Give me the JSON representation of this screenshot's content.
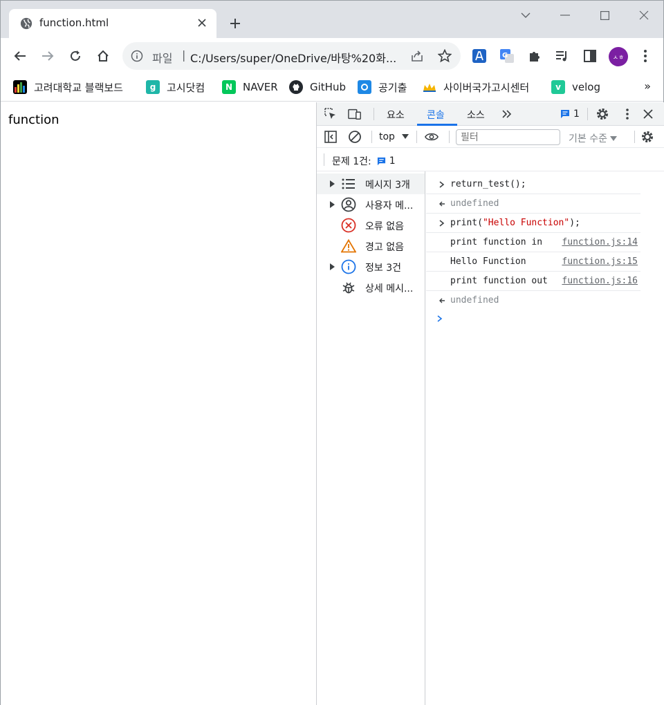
{
  "browser": {
    "tab": {
      "title": "function.html"
    },
    "address": {
      "scheme_label": "파일",
      "separator": "|",
      "url": "C:/Users/super/OneDrive/바탕%20화..."
    },
    "avatar_initials": "ㅅㅎ",
    "bookmarks": [
      {
        "label": "고려대학교 블랙보드",
        "icon": "bar-chart-icon",
        "color": "#e8a500"
      },
      {
        "label": "고시닷컴",
        "icon": "g-icon",
        "color": "#1fb6a8"
      },
      {
        "label": "NAVER",
        "icon": "naver-icon",
        "color": "#03c75a"
      },
      {
        "label": "GitHub",
        "icon": "github-icon",
        "color": "#24292f"
      },
      {
        "label": "공기출",
        "icon": "circle-icon",
        "color": "#1e88e5"
      },
      {
        "label": "사이버국가고시센터",
        "icon": "crown-icon",
        "color": "#f4b400"
      },
      {
        "label": "velog",
        "icon": "v-icon",
        "color": "#20c997"
      }
    ],
    "bookmarks_more": "»"
  },
  "page": {
    "text": "function"
  },
  "devtools": {
    "tabs": [
      "요소",
      "콘솔",
      "소스"
    ],
    "active_tab": "콘솔",
    "issues_badge_count": "1",
    "context": "top",
    "filter_placeholder": "필터",
    "levels": "기본 수준",
    "issues_label": "문제 1건:",
    "issues_count": "1",
    "sidebar": [
      {
        "label": "메시지 3개",
        "icon": "list-icon",
        "expandable": true
      },
      {
        "label": "사용자 메...",
        "icon": "user-icon",
        "expandable": true
      },
      {
        "label": "오류 없음",
        "icon": "error-icon",
        "expandable": false
      },
      {
        "label": "경고 없음",
        "icon": "warning-icon",
        "expandable": false
      },
      {
        "label": "정보 3건",
        "icon": "info-icon",
        "expandable": true
      },
      {
        "label": "상세 메시...",
        "icon": "bug-icon",
        "expandable": false
      }
    ],
    "console_lines": [
      {
        "kind": "input",
        "text": "return_test();"
      },
      {
        "kind": "result",
        "text": "undefined"
      },
      {
        "kind": "input",
        "text_pre": "print(",
        "text_str": "\"Hello Function\"",
        "text_post": ");"
      },
      {
        "kind": "log",
        "text": "print function in ",
        "source": "function.js:14"
      },
      {
        "kind": "log",
        "text": "Hello Function",
        "source": "function.js:15"
      },
      {
        "kind": "log",
        "text": "print function out",
        "source": "function.js:16"
      },
      {
        "kind": "result",
        "text": "undefined"
      }
    ],
    "colors": {
      "accent": "#1a73e8",
      "string": "#c80000"
    }
  }
}
